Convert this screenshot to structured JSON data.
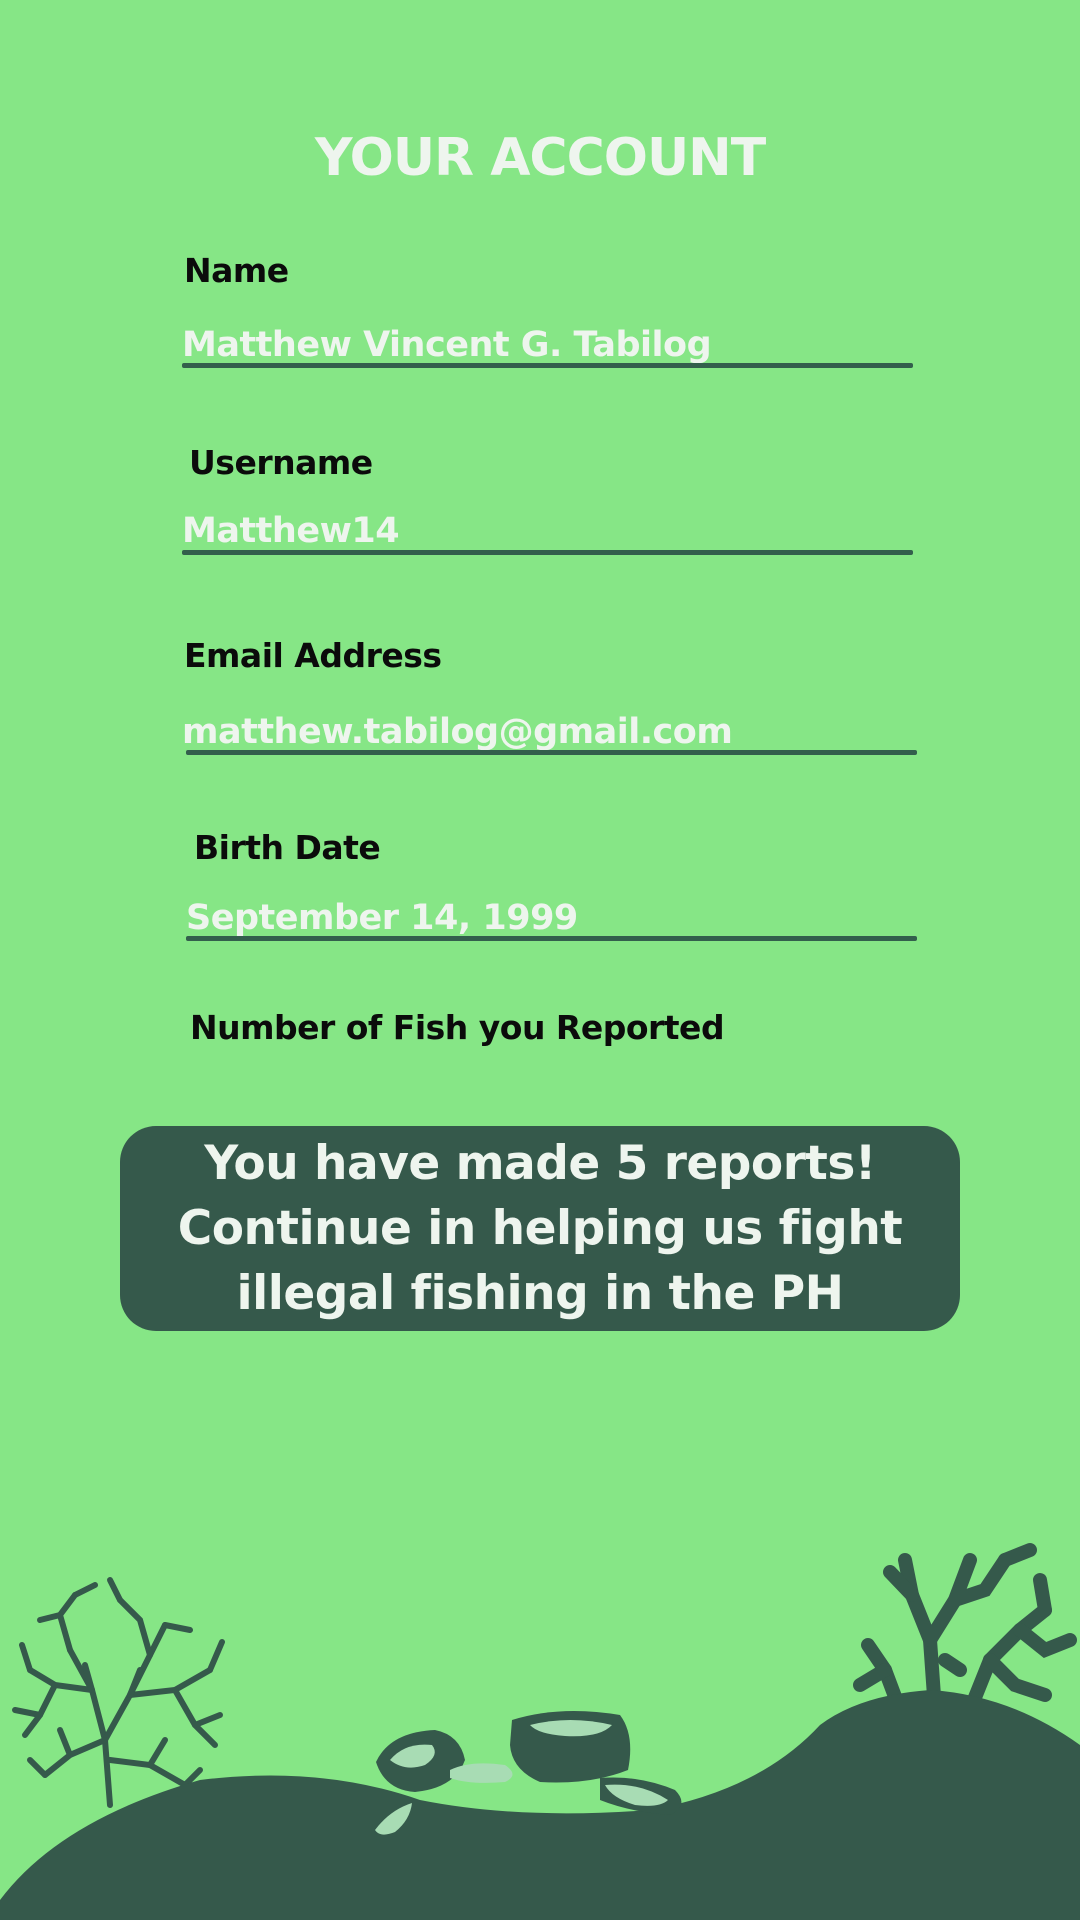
{
  "page": {
    "title": "YOUR ACCOUNT"
  },
  "fields": {
    "name": {
      "label": "Name",
      "value": "Matthew Vincent G. Tabilog"
    },
    "username": {
      "label": "Username",
      "value": "Matthew14"
    },
    "email": {
      "label": "Email Address",
      "value": "matthew.tabilog@gmail.com"
    },
    "birth_date": {
      "label": "Birth Date",
      "value": "September 14, 1999"
    },
    "fish_reported": {
      "label": "Number of Fish you Reported"
    }
  },
  "report_banner": {
    "line1": "You have made 5 reports!",
    "line2": "Continue in helping us fight",
    "line3": "illegal fishing in the PH"
  },
  "colors": {
    "background": "#86e686",
    "dark_green": "#35594b",
    "light_text": "#eef5ee",
    "pebble": "#a8dcb4"
  },
  "decorations": {
    "left": "sea-fan-coral-icon",
    "right": "branch-coral-icon",
    "center": "rocks-icon"
  }
}
